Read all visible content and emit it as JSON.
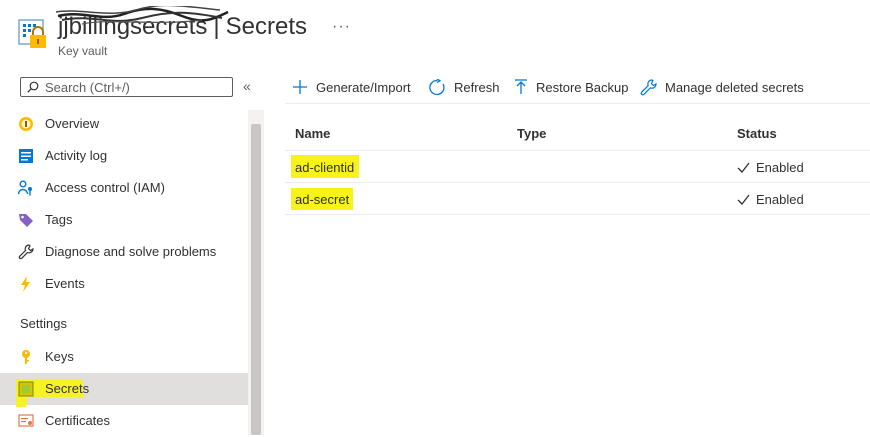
{
  "header": {
    "resource_name": "jjbillingsecrets",
    "separator": "|",
    "page": "Secrets",
    "subtitle": "Key vault",
    "more": "···"
  },
  "sidebar": {
    "search_placeholder": "Search (Ctrl+/)",
    "collapse": "«",
    "items": [
      {
        "label": "Overview",
        "icon": "overview-icon"
      },
      {
        "label": "Activity log",
        "icon": "activity-log-icon"
      },
      {
        "label": "Access control (IAM)",
        "icon": "iam-icon"
      },
      {
        "label": "Tags",
        "icon": "tag-icon"
      },
      {
        "label": "Diagnose and solve problems",
        "icon": "wrench-icon"
      },
      {
        "label": "Events",
        "icon": "lightning-icon"
      }
    ],
    "section": "Settings",
    "settings_items": [
      {
        "label": "Keys",
        "icon": "key-icon"
      },
      {
        "label": "Secrets",
        "icon": "secret-icon",
        "active": true
      },
      {
        "label": "Certificates",
        "icon": "certificate-icon"
      }
    ]
  },
  "toolbar": {
    "generate": "Generate/Import",
    "refresh": "Refresh",
    "restore": "Restore Backup",
    "manage": "Manage deleted secrets"
  },
  "table": {
    "headers": [
      "Name",
      "Type",
      "Status"
    ],
    "rows": [
      {
        "name": "ad-clientid",
        "type": "",
        "status": "Enabled"
      },
      {
        "name": "ad-secret",
        "type": "",
        "status": "Enabled"
      }
    ]
  },
  "colors": {
    "accent": "#0078d4",
    "highlight": "#f7f31a",
    "active_bg": "#e1dfdd"
  }
}
